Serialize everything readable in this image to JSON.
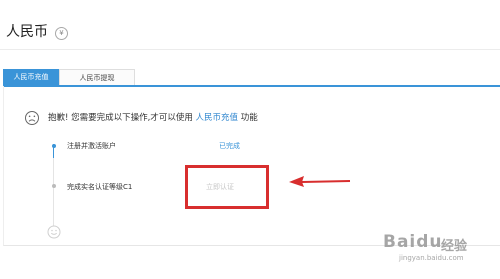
{
  "header": {
    "title": "人民币",
    "currency_symbol": "¥"
  },
  "tabs": [
    {
      "label": "人民币充值",
      "active": true
    },
    {
      "label": "人民币提现",
      "active": false
    }
  ],
  "notice": {
    "prefix": "抱歉! 您需要完成以下操作,才可以使用",
    "link": "人民币充值",
    "suffix": "功能"
  },
  "steps": [
    {
      "label": "注册并激活账户",
      "status": "已完成"
    },
    {
      "label": "完成实名认证等级C1",
      "action": "立即认证"
    }
  ],
  "watermark": {
    "logo": "Baidu",
    "text": "经验",
    "url": "jingyan.baidu.com"
  },
  "colors": {
    "accent": "#3a94d8",
    "highlight": "#d82e2e",
    "muted": "#c7c7c7"
  },
  "icons": {
    "currency": "yen-circle-icon",
    "notice": "sad-face-icon",
    "footer": "smile-face-icon",
    "annotation": "arrow-left-icon"
  }
}
